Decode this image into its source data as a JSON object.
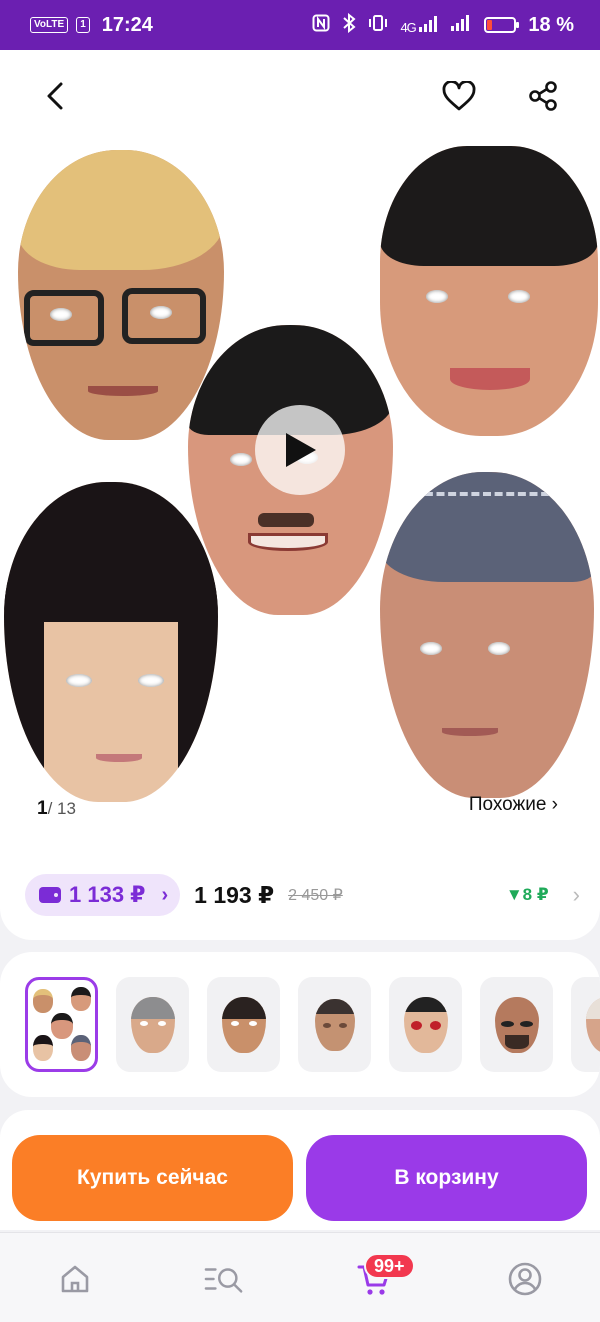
{
  "status_bar": {
    "volte": "VoLTE",
    "sim": "1",
    "time": "17:24",
    "network": "4G",
    "battery_percent_text": "18 %",
    "battery_level": 0.18
  },
  "gallery": {
    "current_index": "1",
    "total_label": "/ 13",
    "similar_label": "Похожие ›"
  },
  "price": {
    "wallet_price": "1 133 ₽",
    "wallet_chevron": "›",
    "price": "1 193 ₽",
    "old_price": "2 450 ₽",
    "discount": "▼8 ₽",
    "chevron": "›"
  },
  "actions": {
    "buy_now": "Купить сейчас",
    "add_to_cart": "В корзину"
  },
  "nav": {
    "cart_badge": "99+"
  },
  "colors": {
    "status_bar": "#6b1fb1",
    "accent_purple": "#9a3ae8",
    "accent_orange": "#fb7e26",
    "discount_green": "#1faa59",
    "badge_red": "#f2384f"
  }
}
